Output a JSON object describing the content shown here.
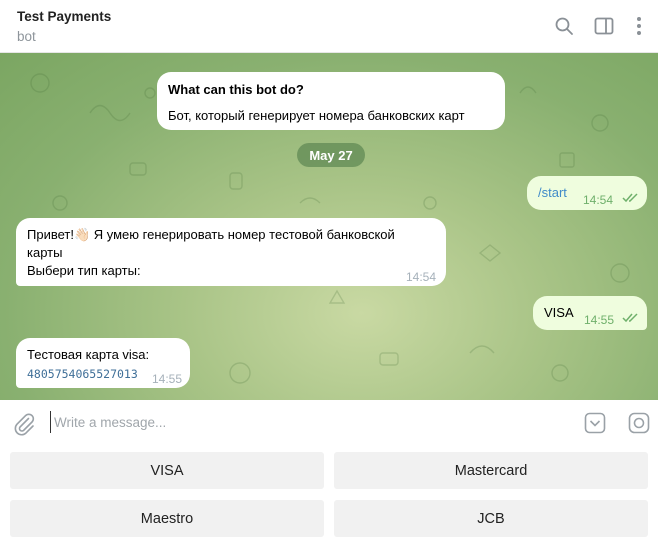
{
  "header": {
    "title": "Test Payments",
    "subtitle": "bot",
    "icons": [
      "search-icon",
      "sidebar-toggle-icon",
      "more-vertical-icon"
    ]
  },
  "chat": {
    "bot_info": {
      "title": "What can this bot do?",
      "text": "Бот, который генерирует номера банковских карт"
    },
    "date_separator": "May 27",
    "messages": [
      {
        "direction": "out",
        "text": "/start",
        "time": "14:54",
        "status": "read"
      },
      {
        "direction": "in",
        "lines": [
          "Привет!👋🏻 Я умею генерировать номер тестовой банковской",
          "карты",
          "Выбери тип карты:"
        ],
        "time": "14:54"
      },
      {
        "direction": "out",
        "text": "VISA",
        "time": "14:55",
        "status": "read"
      },
      {
        "direction": "in",
        "text": "Тестовая карта visa:",
        "card_number": "4805754065527013",
        "time": "14:55"
      }
    ]
  },
  "composer": {
    "placeholder": "Write a message...",
    "value": ""
  },
  "keyboard": {
    "buttons": [
      "VISA",
      "Mastercard",
      "Maestro",
      "JCB"
    ]
  },
  "colors": {
    "chat_bg": "#89b070",
    "outgoing_bubble": "#effdde",
    "incoming_bubble": "#ffffff",
    "link": "#3f8bc9",
    "check": "#6fb06b",
    "date_pill": "#608a54"
  }
}
